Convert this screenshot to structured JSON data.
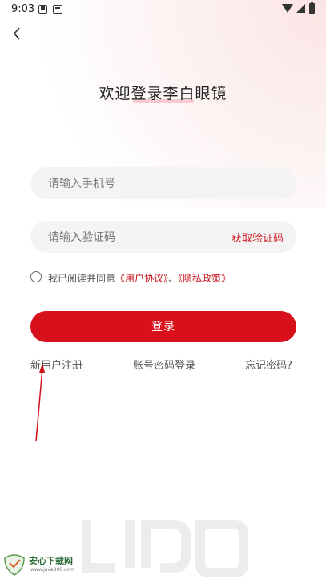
{
  "status_bar": {
    "time": "9:03"
  },
  "header": {
    "title": "欢迎登录李白眼镜"
  },
  "form": {
    "phone_placeholder": "请输入手机号",
    "code_placeholder": "请输入验证码",
    "get_code_label": "获取验证码",
    "agreement_text": "我已阅读并同意",
    "user_agreement_link": "《用户协议》",
    "separator": "、",
    "privacy_policy_link": "《隐私政策》",
    "login_label": "登录"
  },
  "links": {
    "register": "新用户注册",
    "password_login": "账号密码登录",
    "forgot_password": "忘记密码?"
  },
  "watermark_site": {
    "name": "安心下载网",
    "url": "www.java800.com"
  },
  "colors": {
    "accent": "#d8101b",
    "link": "#c8161d",
    "field_bg": "#f4f4f4"
  }
}
